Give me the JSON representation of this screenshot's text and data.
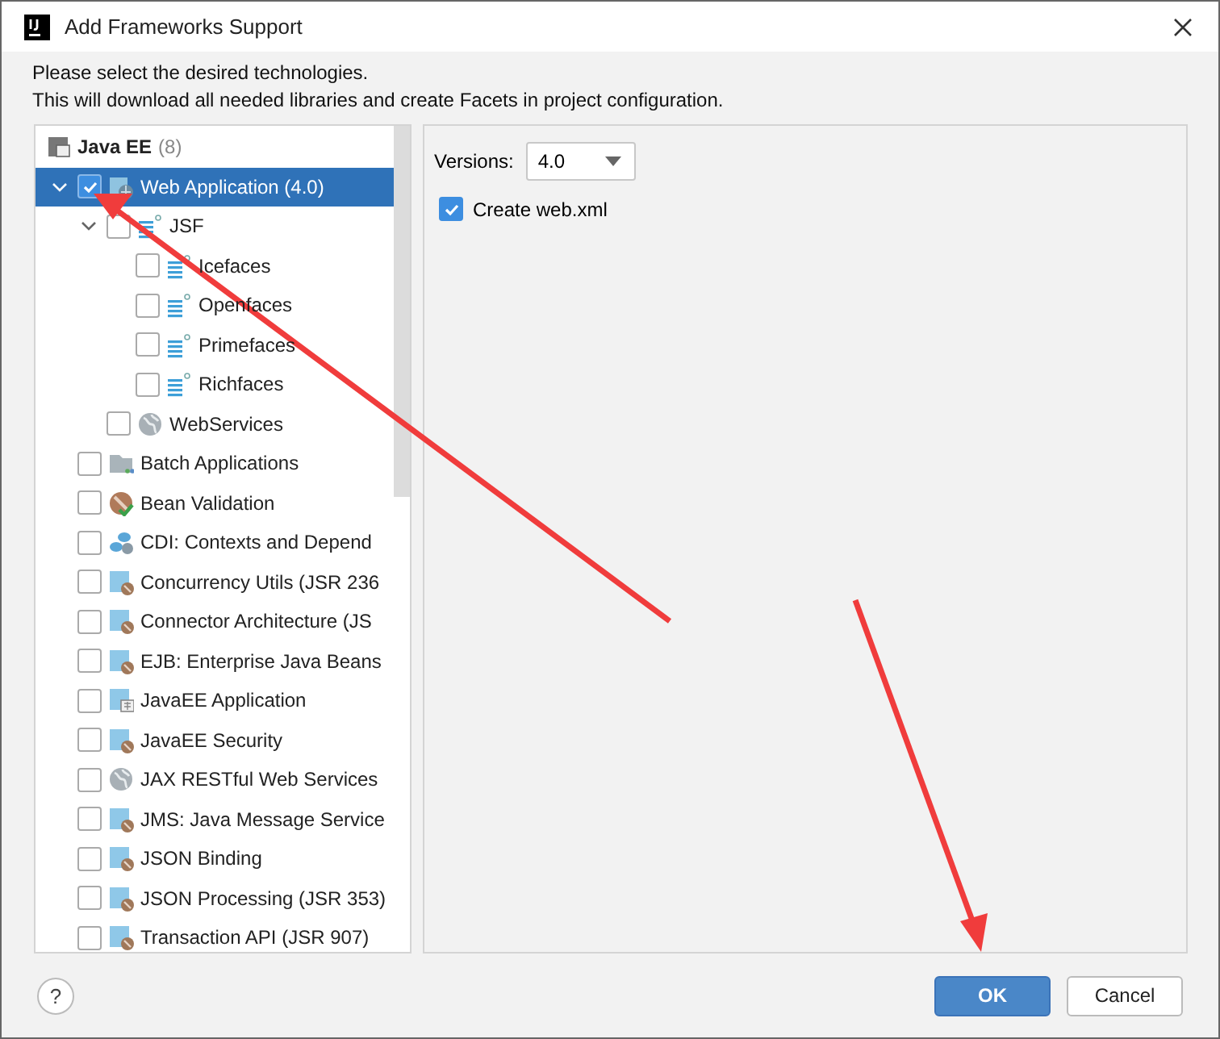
{
  "window": {
    "title": "Add Frameworks Support"
  },
  "intro": [
    "Please select the desired technologies.",
    "This will download all needed libraries and create Facets in project configuration."
  ],
  "tree": {
    "group": {
      "title": "Java EE",
      "count": "(8)"
    },
    "items": [
      {
        "label": "Web Application (4.0)",
        "kind": "web",
        "checked": true,
        "selected": true,
        "expanded": true,
        "children": [
          {
            "label": "JSF",
            "kind": "jsf",
            "checked": false,
            "selected": false,
            "expanded": true,
            "children": [
              {
                "label": "Icefaces",
                "kind": "jsf",
                "checked": false,
                "selected": false
              },
              {
                "label": "Openfaces",
                "kind": "jsf",
                "checked": false,
                "selected": false
              },
              {
                "label": "Primefaces",
                "kind": "jsf",
                "checked": false,
                "selected": false
              },
              {
                "label": "Richfaces",
                "kind": "jsf",
                "checked": false,
                "selected": false
              }
            ]
          },
          {
            "label": "WebServices",
            "kind": "globe",
            "checked": false,
            "selected": false
          }
        ]
      },
      {
        "label": "Batch Applications",
        "kind": "folder",
        "checked": false,
        "selected": false
      },
      {
        "label": "Bean Validation",
        "kind": "bean",
        "checked": false,
        "selected": false
      },
      {
        "label": "CDI: Contexts and Depend",
        "kind": "cdi",
        "checked": false,
        "selected": false
      },
      {
        "label": "Concurrency Utils (JSR 236",
        "kind": "module",
        "checked": false,
        "selected": false
      },
      {
        "label": "Connector Architecture (JS",
        "kind": "module",
        "checked": false,
        "selected": false
      },
      {
        "label": "EJB: Enterprise Java Beans",
        "kind": "module",
        "checked": false,
        "selected": false
      },
      {
        "label": "JavaEE Application",
        "kind": "app",
        "checked": false,
        "selected": false
      },
      {
        "label": "JavaEE Security",
        "kind": "module",
        "checked": false,
        "selected": false
      },
      {
        "label": "JAX RESTful Web Services",
        "kind": "globe",
        "checked": false,
        "selected": false
      },
      {
        "label": "JMS: Java Message Service",
        "kind": "module",
        "checked": false,
        "selected": false
      },
      {
        "label": "JSON Binding",
        "kind": "module",
        "checked": false,
        "selected": false
      },
      {
        "label": "JSON Processing (JSR 353)",
        "kind": "module",
        "checked": false,
        "selected": false
      },
      {
        "label": "Transaction API (JSR 907)",
        "kind": "module",
        "checked": false,
        "selected": false
      }
    ]
  },
  "settings": {
    "versions_label": "Versions:",
    "version": "4.0",
    "create_label": "Create web.xml",
    "create_checked": true
  },
  "buttons": {
    "help": "?",
    "ok": "OK",
    "cancel": "Cancel"
  }
}
